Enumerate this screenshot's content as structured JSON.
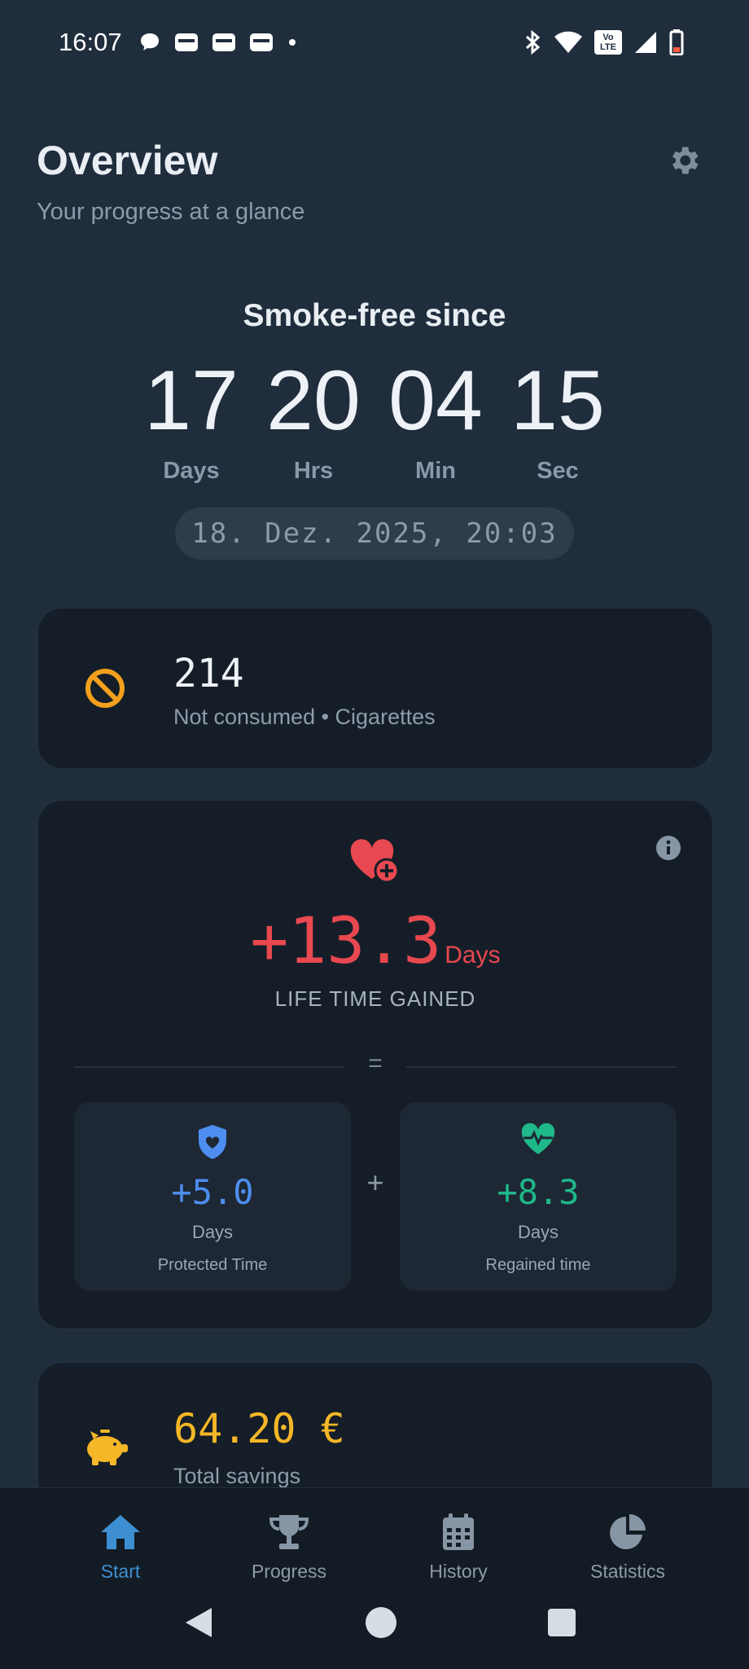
{
  "status_bar": {
    "time": "16:07",
    "volte_label": "Vo LTE"
  },
  "header": {
    "title": "Overview",
    "subtitle": "Your progress at a glance"
  },
  "timer": {
    "title": "Smoke-free since",
    "units": [
      {
        "value": "17",
        "label": "Days"
      },
      {
        "value": "20",
        "label": "Hrs"
      },
      {
        "value": "04",
        "label": "Min"
      },
      {
        "value": "15",
        "label": "Sec"
      }
    ],
    "start_date": "18. Dez. 2025, 20:03"
  },
  "cigarettes": {
    "count": "214",
    "label": "Not consumed • Cigarettes"
  },
  "life": {
    "value": "+13.3",
    "unit": "Days",
    "caption": "LIFE TIME GAINED",
    "equals": "=",
    "plus": "+",
    "protected": {
      "value": "+5.0",
      "unit": "Days",
      "label": "Protected Time"
    },
    "regained": {
      "value": "+8.3",
      "unit": "Days",
      "label": "Regained time"
    }
  },
  "savings": {
    "value": "64.20 €",
    "label": "Total savings"
  },
  "nav": {
    "items": [
      {
        "label": "Start",
        "active": true
      },
      {
        "label": "Progress",
        "active": false
      },
      {
        "label": "History",
        "active": false
      },
      {
        "label": "Statistics",
        "active": false
      }
    ]
  },
  "colors": {
    "background": "#1f2d3d",
    "card": "#151e28",
    "accent_blue": "#3d8fd1",
    "life_red": "#e8484f",
    "protected_blue": "#4d8ef0",
    "regained_green": "#1fb88a",
    "savings_yellow": "#f5b727",
    "warning_orange": "#f2a01d"
  }
}
